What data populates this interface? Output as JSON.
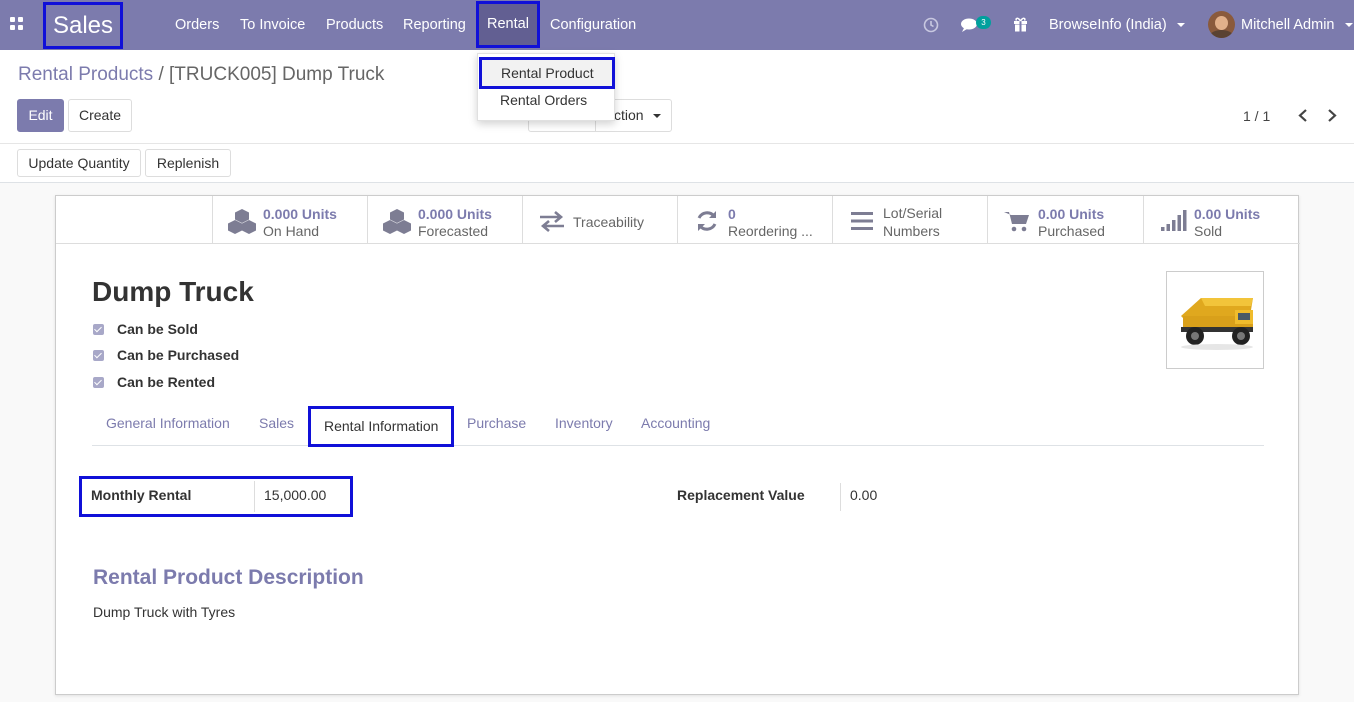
{
  "navbar": {
    "app_name": "Sales",
    "menus": [
      "Orders",
      "To Invoice",
      "Products",
      "Reporting",
      "Rental",
      "Configuration"
    ],
    "message_count": "3",
    "company": "BrowseInfo (India)",
    "user": "Mitchell Admin",
    "icons": [
      "apps-grid-icon",
      "clock-icon",
      "chat-icon",
      "gift-icon"
    ]
  },
  "rental_menu": {
    "items": [
      "Rental Product",
      "Rental Orders"
    ]
  },
  "breadcrumb": {
    "parent": "Rental Products",
    "separator": "/",
    "current": "[TRUCK005] Dump Truck"
  },
  "toolbar": {
    "edit": "Edit",
    "create": "Create",
    "action_partial": "ction",
    "pager": "1 / 1",
    "update_quantity": "Update Quantity",
    "replenish": "Replenish"
  },
  "smart_buttons": [
    {
      "value": "0.000 Units",
      "label": "On Hand",
      "icon": "cubes-icon"
    },
    {
      "value": "0.000 Units",
      "label": "Forecasted",
      "icon": "cubes-icon"
    },
    {
      "label": "Traceability",
      "icon": "exchange-icon"
    },
    {
      "value": "0",
      "label": "Reordering ...",
      "icon": "refresh-icon"
    },
    {
      "value": "Lot/Serial",
      "label": "Numbers",
      "icon": "list-icon"
    },
    {
      "value": "0.00 Units",
      "label": "Purchased",
      "icon": "cart-icon"
    },
    {
      "value": "0.00 Units",
      "label": "Sold",
      "icon": "signal-icon"
    }
  ],
  "product": {
    "name": "Dump Truck",
    "checkboxes": [
      {
        "label": "Can be Sold",
        "checked": true
      },
      {
        "label": "Can be Purchased",
        "checked": true
      },
      {
        "label": "Can be Rented",
        "checked": true
      }
    ]
  },
  "tabs": [
    "General Information",
    "Sales",
    "Rental Information",
    "Purchase",
    "Inventory",
    "Accounting"
  ],
  "active_tab": "Rental Information",
  "rental_info": {
    "monthly_rental_label": "Monthly Rental",
    "monthly_rental_value": "15,000.00",
    "replacement_label": "Replacement Value",
    "replacement_value": "0.00",
    "section_title": "Rental Product Description",
    "description": "Dump Truck with Tyres"
  },
  "colors": {
    "brand": "#7c7bad",
    "highlight": "#1010d8"
  }
}
